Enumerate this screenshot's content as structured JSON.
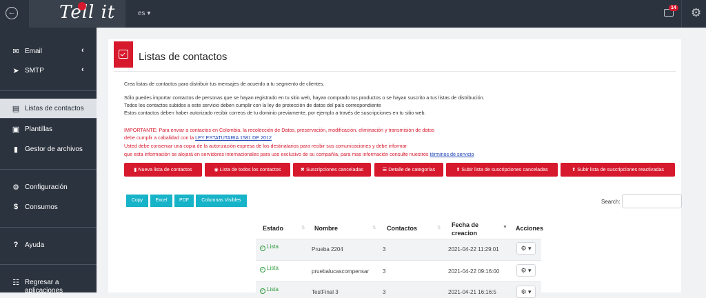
{
  "topbar": {
    "logo_text": "Tell it",
    "language": "es ▾",
    "messages_badge": "14"
  },
  "sidebar": {
    "items": [
      {
        "label": "Email",
        "icon": "envelope-icon"
      },
      {
        "label": "SMTP",
        "icon": "rocket-icon"
      },
      {
        "label": "Listas de contactos",
        "icon": "book-icon"
      },
      {
        "label": "Plantillas",
        "icon": "document-icon"
      },
      {
        "label": "Gestor de archivos",
        "icon": "file-icon"
      },
      {
        "label": "Configuración",
        "icon": "gear-icon"
      },
      {
        "label": "Consumos",
        "icon": "dollar-icon"
      },
      {
        "label": "Ayuda",
        "icon": "question-icon"
      },
      {
        "label": "Regresar a aplicaciones",
        "icon": "grid-icon"
      }
    ]
  },
  "page": {
    "title": "Listas de contactos",
    "intro": "Crea listas de contactos para distribuir tus mensajes de acuerdo a tu segmento de clientes.",
    "info_1": "Sólo puedes importar contactos de personas que se hayan registrado en tu sitio web, hayan comprado tus productos o se hayan suscrito a tus listas de distribución.",
    "info_2": "Todos los contactos subidos a este servicio deben cumplir con la ley de protección de datos del país correspondiente",
    "info_3": "Estos contactos deben haber autorizado recibir correos de tu dominio previamente, por ejemplo a través de suscripciones en tu sitio web.",
    "warn_1": "IMPORTANTE: Para enviar a contactos en Colombia, la recolección de Datos, preservación, modificación, eliminación y transmisión de datos",
    "warn_2_prefix": "debe cumplir a cabalidad con la ",
    "warn_2_link": "LEY ESTATUTARIA 1581 DE 2012",
    "warn_3": "Usted debe conservar una copia de la autorización expresa de los destinatarios para recibir sus comunicaciones y debe informar",
    "warn_4_prefix": "que esta información se alojará en servidores internacionales para uso exclusivo de su compañía, para mas información consulte nuestros ",
    "warn_4_link": "términos de servicio"
  },
  "actions": {
    "new_list": "Nueva lista de contactos",
    "all_contacts": "Lista de todos los contactos",
    "cancelled_subs": "Suscripciones canceladas",
    "category_detail": "Detalle de categorías",
    "upload_cancelled": "Subir lista de suscripciones canceladas",
    "upload_reactivated": "Subir lista de suscripciones reactivadas"
  },
  "export": {
    "copy": "Copy",
    "excel": "Excel",
    "pdf": "PDF",
    "columns": "Columnas Visibles"
  },
  "search": {
    "label": "Search:",
    "value": ""
  },
  "table": {
    "headers": {
      "estado": "Estado",
      "nombre": "Nombre",
      "contactos": "Contactos",
      "fecha_1": "Fecha de",
      "fecha_2": "creacion",
      "acciones": "Acciones"
    },
    "rows": [
      {
        "estado": "Lista",
        "nombre": "Prueba 2204",
        "contactos": "3",
        "fecha": "2021-04-22 11:29:01"
      },
      {
        "estado": "Lista",
        "nombre": "pruebalucascompensar",
        "contactos": "3",
        "fecha": "2021-04-22 09:16:00"
      },
      {
        "estado": "Lista",
        "nombre": "TestFinal 3",
        "contactos": "3",
        "fecha": "2021-04-21 16:16:5"
      }
    ]
  },
  "colors": {
    "brand_red": "#d7192d",
    "accent_cyan": "#17b3c8",
    "sidebar_bg": "#2b333e",
    "status_green": "#2e9b3d"
  }
}
